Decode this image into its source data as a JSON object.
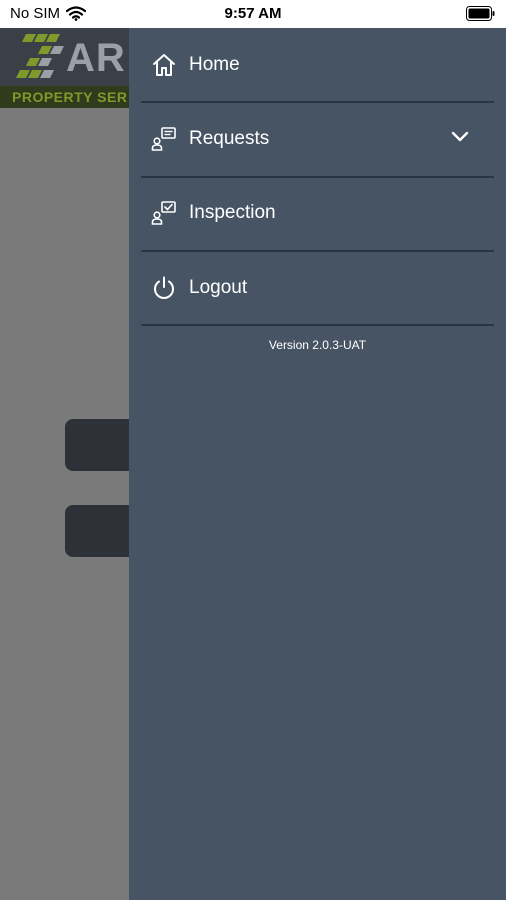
{
  "status_bar": {
    "carrier": "No SIM",
    "time": "9:57 AM"
  },
  "background_app": {
    "logo_letters": "AR",
    "logo_tagline": "PROPERTY SER"
  },
  "drawer": {
    "items": [
      {
        "label": "Home",
        "icon": "home-icon"
      },
      {
        "label": "Requests",
        "icon": "requests-icon",
        "expandable": true
      },
      {
        "label": "Inspection",
        "icon": "inspection-icon"
      },
      {
        "label": "Logout",
        "icon": "power-icon"
      }
    ],
    "version": "Version 2.0.3-UAT"
  },
  "colors": {
    "drawer_bg": "#465464",
    "divider": "#2c3643",
    "overlay": "#7a7a7a",
    "logo_green": "#7d9a2b"
  }
}
